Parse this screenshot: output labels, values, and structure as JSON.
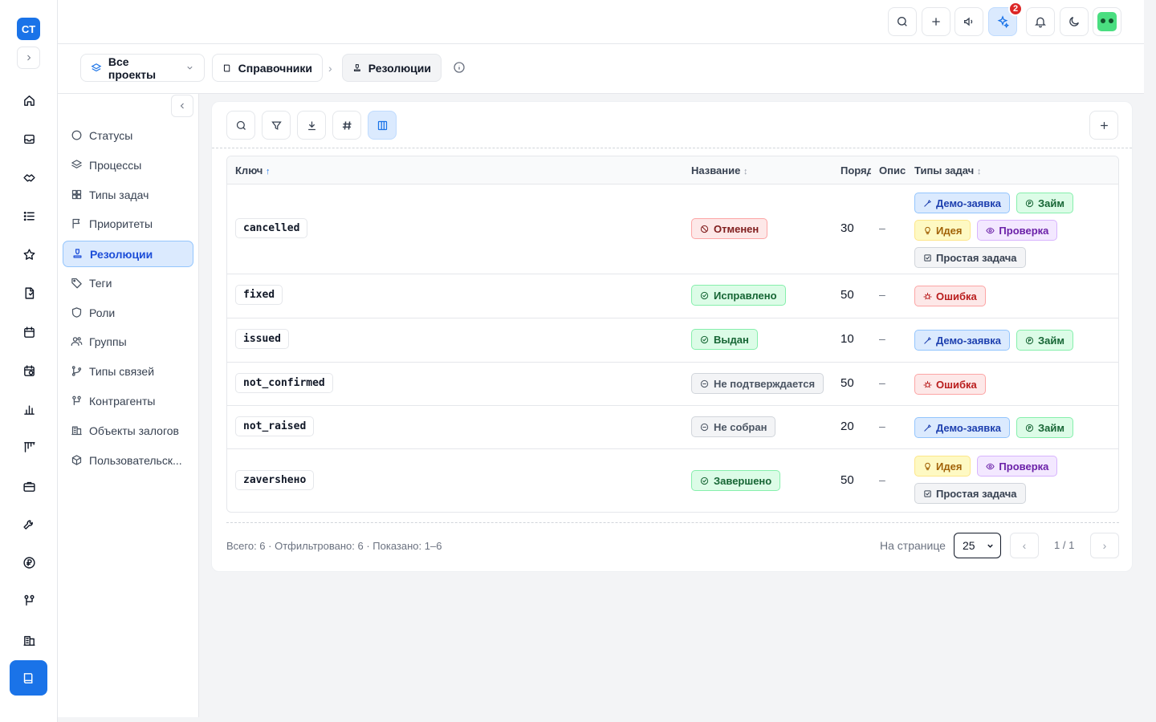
{
  "app": {
    "logo_text": "CT"
  },
  "rail": {
    "icons": [
      "home-icon",
      "inbox-icon",
      "handshake-icon",
      "list-icon",
      "star-icon",
      "document-icon",
      "calendar-icon",
      "calendar-check-icon",
      "bar-chart-icon",
      "kanban-icon",
      "briefcase-icon",
      "tool-icon",
      "ruble-icon",
      "contractors-icon",
      "building-icon",
      "book-icon"
    ]
  },
  "topbar": {
    "notifications_count": "2"
  },
  "breadcrumb": {
    "projects": "Все проекты",
    "references": "Справочники",
    "current": "Резолюции"
  },
  "sidebar": {
    "items": [
      {
        "label": "Статусы",
        "icon": "circle-icon"
      },
      {
        "label": "Процессы",
        "icon": "layers-icon"
      },
      {
        "label": "Типы задач",
        "icon": "grid-icon"
      },
      {
        "label": "Приоритеты",
        "icon": "flag-icon"
      },
      {
        "label": "Резолюции",
        "icon": "stamp-icon"
      },
      {
        "label": "Теги",
        "icon": "tag-icon"
      },
      {
        "label": "Роли",
        "icon": "shield-icon"
      },
      {
        "label": "Группы",
        "icon": "users-icon"
      },
      {
        "label": "Типы связей",
        "icon": "branch-icon"
      },
      {
        "label": "Контрагенты",
        "icon": "contractors-icon"
      },
      {
        "label": "Объекты залогов",
        "icon": "building-icon"
      },
      {
        "label": "Пользовательск...",
        "icon": "cube-icon"
      }
    ],
    "active_index": 4
  },
  "table": {
    "columns": {
      "key": "Ключ",
      "name": "Название",
      "order": "Поряд",
      "desc": "Опис",
      "types": "Типы задач"
    },
    "rows": [
      {
        "key": "cancelled",
        "name": "Отменен",
        "status_style": "red",
        "order": "30",
        "desc": "–",
        "types": [
          "Демо-заявка",
          "Займ",
          "Идея",
          "Проверка",
          "Простая задача"
        ]
      },
      {
        "key": "fixed",
        "name": "Исправлено",
        "status_style": "green",
        "order": "50",
        "desc": "–",
        "types": [
          "Ошибка"
        ]
      },
      {
        "key": "issued",
        "name": "Выдан",
        "status_style": "green",
        "order": "10",
        "desc": "–",
        "types": [
          "Демо-заявка",
          "Займ"
        ]
      },
      {
        "key": "not_confirmed",
        "name": "Не подтверждается",
        "status_style": "gray",
        "order": "50",
        "desc": "–",
        "types": [
          "Ошибка"
        ]
      },
      {
        "key": "not_raised",
        "name": "Не собран",
        "status_style": "gray",
        "order": "20",
        "desc": "–",
        "types": [
          "Демо-заявка",
          "Займ"
        ]
      },
      {
        "key": "zavershено",
        "name": "Завершено",
        "status_style": "green",
        "order": "50",
        "desc": "–",
        "types": [
          "Идея",
          "Проверка",
          "Простая задача"
        ]
      }
    ]
  },
  "footer": {
    "summary": "Всего: 6 · Отфильтровано: 6 · Показано: 1–6",
    "per_page_label": "На странице",
    "per_page_value": "25",
    "page_label": "1 / 1",
    "prev": "‹",
    "next": "›"
  },
  "colors": {
    "accent": "#1a73e8",
    "red": "#dc2626",
    "green": "#15803d"
  }
}
